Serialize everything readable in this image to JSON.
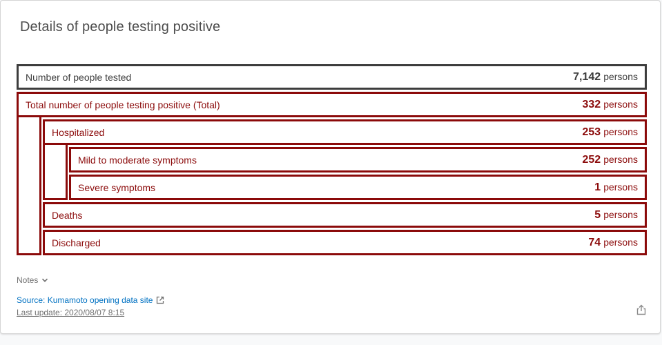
{
  "card": {
    "title": "Details of people testing positive"
  },
  "tested": {
    "label": "Number of people tested",
    "value": "7,142",
    "unit": "persons"
  },
  "total": {
    "label": "Total number of people testing positive (Total)",
    "value": "332",
    "unit": "persons"
  },
  "hospitalized": {
    "label": "Hospitalized",
    "value": "253",
    "unit": "persons"
  },
  "mild": {
    "label": "Mild to moderate symptoms",
    "value": "252",
    "unit": "persons"
  },
  "severe": {
    "label": "Severe symptoms",
    "value": "1",
    "unit": "persons"
  },
  "deaths": {
    "label": "Deaths",
    "value": "5",
    "unit": "persons"
  },
  "discharged": {
    "label": "Discharged",
    "value": "74",
    "unit": "persons"
  },
  "footer": {
    "notes_label": "Notes",
    "source_label": "Source: Kumamoto opening data site",
    "last_update": "Last update: 2020/08/07 8:15"
  },
  "icons": {
    "notes_toggle": "chevron-down-icon",
    "external_link": "external-link-icon",
    "share": "share-icon"
  },
  "colors": {
    "accent": "#8b0a0a",
    "tested_border": "#3d3d3d",
    "link": "#0071c2"
  }
}
